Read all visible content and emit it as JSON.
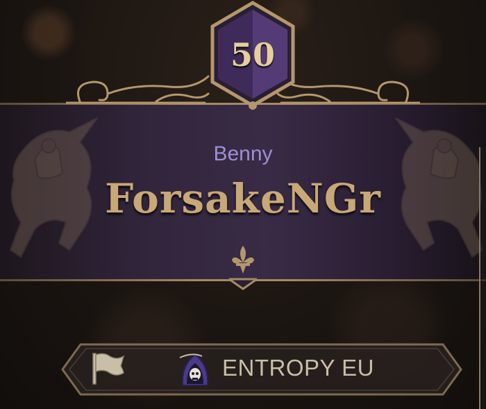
{
  "profile": {
    "level": "50",
    "title": "Benny",
    "player_name": "ForsakeNGr"
  },
  "guild": {
    "name": "ENTROPY EU",
    "flag_icon": "flag-icon",
    "emblem_icon": "reaper-icon"
  },
  "colors": {
    "level_badge": "#4b3468",
    "title_text": "#9d8fd2",
    "name_text": "#c9a877",
    "banner": "#3a2c48",
    "gold_trim": "#a58a66"
  }
}
